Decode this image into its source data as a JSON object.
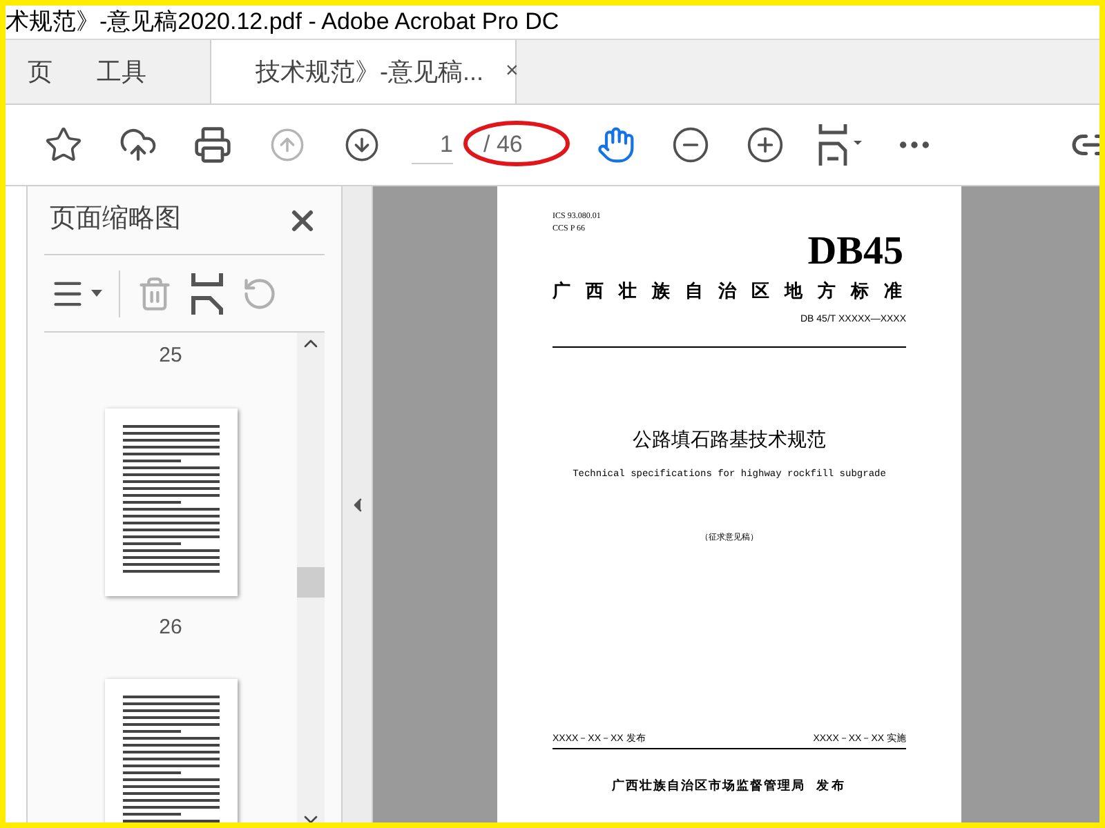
{
  "window": {
    "title": "术规范》-意见稿2020.12.pdf - Adobe Acrobat Pro DC"
  },
  "tabs": [
    {
      "label": "页",
      "selected": false
    },
    {
      "label": "工具",
      "selected": false
    },
    {
      "label": "技术规范》-意见稿...",
      "selected": true,
      "close": "×"
    }
  ],
  "toolbar": {
    "page_field": {
      "value": "1"
    },
    "page_total": "/ 46",
    "hand_tool_selected": true
  },
  "thumbnail_panel": {
    "title": "页面缩略图",
    "pages": [
      {
        "label": "25"
      },
      {
        "label": "26"
      }
    ]
  },
  "document": {
    "codes": [
      "ICS 93.080.01",
      "CCS P 66"
    ],
    "logo": "DB45",
    "authority": "广西壮族自治区地方标准",
    "number": "DB 45/T XXXXX—XXXX",
    "title": "公路填石路基技术规范",
    "subtitle": "Technical specifications for highway rockfill subgrade",
    "stage": "（征求意见稿）",
    "issue_date": "XXXX－XX－XX 发布",
    "effective_date": "XXXX－XX－XX 实施",
    "issuer": "广西壮族自治区市场监督管理局",
    "issuer_suffix": "发布"
  }
}
